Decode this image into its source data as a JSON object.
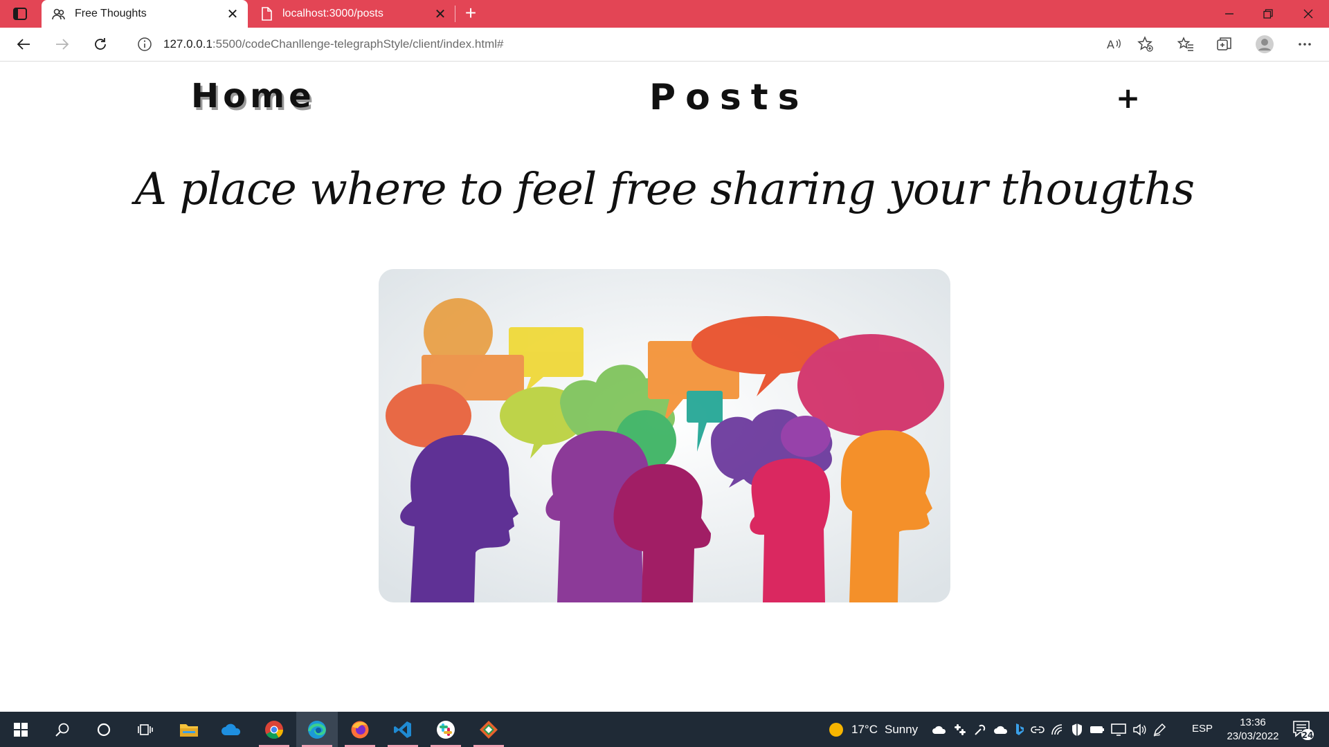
{
  "browser": {
    "tabs": [
      {
        "title": "Free Thoughts",
        "active": true
      },
      {
        "title": "localhost:3000/posts",
        "active": false
      }
    ],
    "address": {
      "host": "127.0.0.1",
      "rest": ":5500/codeChanllenge-telegraphStyle/client/index.html#"
    }
  },
  "page": {
    "nav": {
      "home": "Home",
      "posts": "Posts",
      "add": "+"
    },
    "tagline": "A place where to feel free sharing your thougths"
  },
  "taskbar": {
    "weather": {
      "temp": "17°C",
      "condition": "Sunny"
    },
    "language": "ESP",
    "time": "13:36",
    "date": "23/03/2022",
    "notification_count": "24"
  },
  "colors": {
    "tabbar": "#e34555",
    "taskbar": "#1f2a36"
  }
}
